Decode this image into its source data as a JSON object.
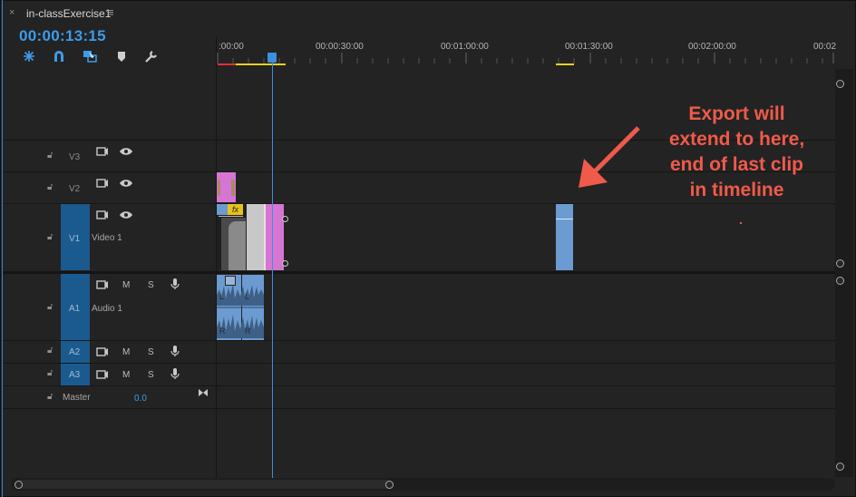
{
  "tab": {
    "close": "×",
    "title": "in-classExercise1",
    "menu": "≡"
  },
  "timecode": "00:00:13:15",
  "ruler": {
    "labels": [
      ":00:00",
      "00:00:30:00",
      "00:01:00:00",
      "00:01:30:00",
      "00:02:00:00",
      "00:02"
    ]
  },
  "tracks": {
    "v3": {
      "name": "V3"
    },
    "v2": {
      "name": "V2"
    },
    "v1": {
      "name": "V1",
      "label": "Video 1"
    },
    "a1": {
      "name": "A1",
      "label": "Audio 1",
      "m": "M",
      "s": "S"
    },
    "a2": {
      "name": "A2",
      "m": "M",
      "s": "S"
    },
    "a3": {
      "name": "A3",
      "m": "M",
      "s": "S"
    },
    "master": {
      "label": "Master",
      "value": "0.0"
    }
  },
  "clips": {
    "fx": "fx",
    "audio_l": "L",
    "audio_r": "R"
  },
  "annotation": {
    "line1": "Export will",
    "line2": "extend to here,",
    "line3": "end of last clip",
    "line4": "in timeline"
  },
  "colors": {
    "accent": "#3d9bea",
    "annotation": "#f05a4a",
    "clip_pink": "#d775d2",
    "clip_blue": "#6b9bd1"
  },
  "icons": [
    "close-icon",
    "menu-icon",
    "snap-icon",
    "magnet-icon",
    "linked-selection-icon",
    "marker-icon",
    "wrench-icon",
    "lock-icon",
    "film-icon",
    "eye-icon",
    "mic-icon",
    "bowtie-icon"
  ]
}
